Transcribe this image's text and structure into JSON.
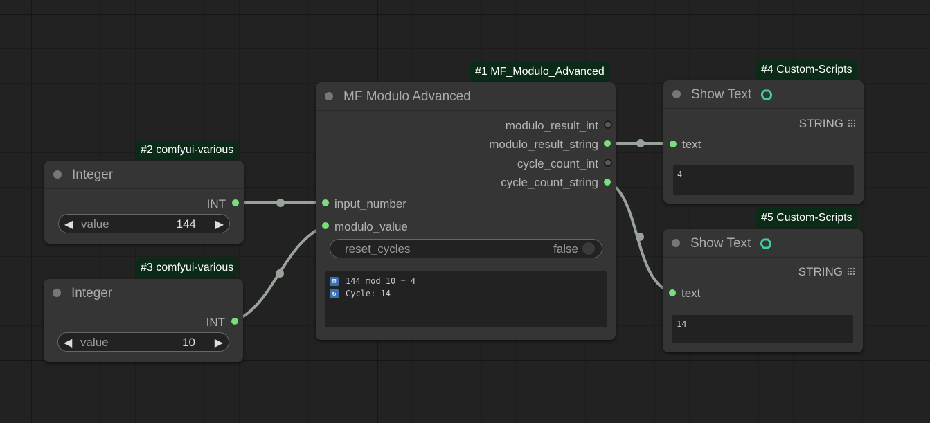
{
  "badges": {
    "node1": "#1 MF_Modulo_Advanced",
    "node2": "#2 comfyui-various",
    "node3": "#3 comfyui-various",
    "node4": "#4 Custom-Scripts",
    "node5": "#5 Custom-Scripts"
  },
  "node1": {
    "title": "MF Modulo Advanced",
    "outputs": [
      "modulo_result_int",
      "modulo_result_string",
      "cycle_count_int",
      "cycle_count_string"
    ],
    "inputs": [
      "input_number",
      "modulo_value"
    ],
    "toggle": {
      "label": "reset_cycles",
      "value": "false"
    },
    "output_text": [
      "144 mod 10 = 4",
      "Cycle: 14"
    ]
  },
  "node2": {
    "title": "Integer",
    "output": "INT",
    "widget": {
      "label": "value",
      "value": "144"
    }
  },
  "node3": {
    "title": "Integer",
    "output": "INT",
    "widget": {
      "label": "value",
      "value": "10"
    }
  },
  "node4": {
    "title": "Show Text",
    "output": "STRING",
    "input": "text",
    "text_value": "4"
  },
  "node5": {
    "title": "Show Text",
    "output": "STRING",
    "input": "text",
    "text_value": "14"
  },
  "colors": {
    "canvas": "#222222",
    "node": "#353535",
    "link": "#9aa39a",
    "slot_connected": "#78e07a",
    "badge": "#0b2a17",
    "custom_scripts_icon": "#3fcf9e"
  }
}
